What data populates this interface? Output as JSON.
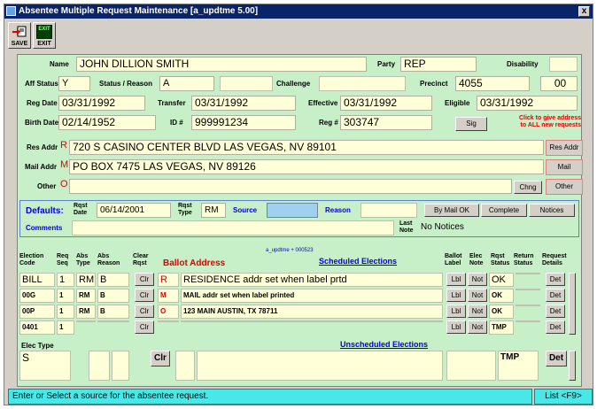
{
  "window": {
    "title": "Absentee Multiple Request Maintenance  [a_updtme 5.00]",
    "close": "x"
  },
  "toolbar": {
    "save_label": "SAVE",
    "exit_label": "EXIT",
    "exit_icon_text": "EXIT"
  },
  "voter": {
    "name_label": "Name",
    "name": "JOHN DILLION SMITH",
    "party_label": "Party",
    "party": "REP",
    "disability_label": "Disability",
    "aff_status_label": "Aff Status",
    "aff_status": "Y",
    "status_reason_label": "Status / Reason",
    "status_reason": "A",
    "challenge_label": "Challenge",
    "precinct_label": "Precinct",
    "precinct": "4055",
    "precinct_sub": "00",
    "reg_date_label": "Reg Date",
    "reg_date": "03/31/1992",
    "transfer_label": "Transfer",
    "transfer": "03/31/1992",
    "effective_label": "Effective",
    "effective": "03/31/1992",
    "eligible_label": "Eligible",
    "eligible": "03/31/1992",
    "birth_date_label": "Birth Date",
    "birth_date": "02/14/1952",
    "id_label": "ID #",
    "id": "999991234",
    "reg_num_label": "Reg #",
    "reg_num": "303747",
    "sig_button": "Sig",
    "hint": [
      "Click to give address",
      "to ALL new requests"
    ],
    "res_addr_label": "Res Addr",
    "res_code": "R",
    "res_addr": "720  S CASINO CENTER BLVD   LAS VEGAS, NV 89101",
    "mail_addr_label": "Mail Addr",
    "mail_code": "M",
    "mail_addr": "PO BOX 7475 LAS VEGAS, NV 89126",
    "other_label": "Other",
    "other_code": "O",
    "other_addr": "",
    "chng_button": "Chng",
    "res_addr_button": "Res Addr",
    "mail_button": "Mail",
    "other_button": "Other"
  },
  "defaults": {
    "label": "Defaults:",
    "rqst_date_label": "Rqst Date",
    "rqst_date": "06/14/2001",
    "rqst_type_label": "Rqst Type",
    "rqst_type": "RM",
    "source_label": "Source",
    "reason_label": "Reason",
    "by_mail_ok": "By Mail OK",
    "complete": "Complete",
    "notices": "Notices",
    "comments_label": "Comments",
    "last_note_label": "Last Note",
    "last_note": "No Notices"
  },
  "grid": {
    "headers": {
      "election_code": "Election Code",
      "req_seq": "Req Seq",
      "abs_type": "Abs Type",
      "abs_reason": "Abs Reason",
      "clear_rqst": "Clear Rqst",
      "ballot_address": "Ballot Address",
      "updtme_note": "a_updtme + 000523",
      "scheduled": "Scheduled Elections",
      "ballot_label": "Ballot Label",
      "elec_note": "Elec Note",
      "rqst_status": "Rqst Status",
      "return_status": "Return Status",
      "request_details": "Request Details"
    },
    "rows": [
      {
        "code": "BILL",
        "seq": "1",
        "type": "RM",
        "reason": "B",
        "clr": "Clr",
        "addr_code": "R",
        "address": "RESIDENCE  addr set when label prtd",
        "lbl": "Lbl",
        "not": "Not",
        "status": "OK",
        "det": "Det"
      },
      {
        "code": "00G",
        "seq": "1",
        "type": "RM",
        "reason": "B",
        "clr": "Clr",
        "addr_code": "M",
        "address": "MAIL addr set when label printed",
        "lbl": "Lbl",
        "not": "Not",
        "status": "OK",
        "det": "Det"
      },
      {
        "code": "00P",
        "seq": "1",
        "type": "RM",
        "reason": "B",
        "clr": "Clr",
        "addr_code": "O",
        "address": "123 MAIN AUSTIN, TX 78711",
        "lbl": "Lbl",
        "not": "Not",
        "status": "OK",
        "det": "Det"
      },
      {
        "code": "0401",
        "seq": "1",
        "type": "",
        "reason": "",
        "clr": "Clr",
        "addr_code": "",
        "address": "",
        "lbl": "Lbl",
        "not": "Not",
        "status": "TMP",
        "det": "Det"
      }
    ],
    "elec_type_label": "Elec Type",
    "unscheduled": "Unscheduled Elections",
    "unsched_row": {
      "code": "S",
      "clr": "Clr",
      "status": "TMP",
      "det": "Det"
    }
  },
  "status": {
    "message": "Enter or Select a source for the absentee request.",
    "list_button": "List <F9>"
  }
}
